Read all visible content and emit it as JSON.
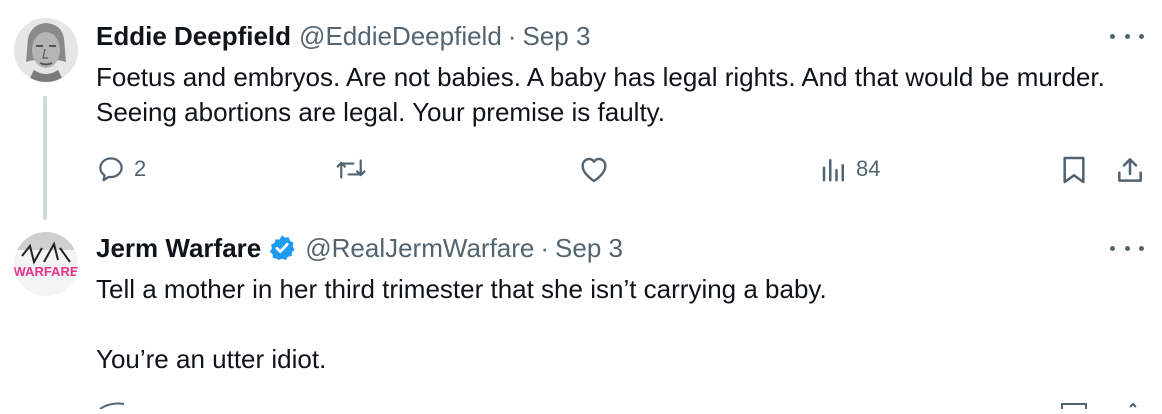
{
  "tweets": [
    {
      "name": "Eddie Deepfield",
      "handle": "@EddieDeepfield",
      "separator": "·",
      "date": "Sep 3",
      "text": "Foetus and embryos. Are not babies. A baby has legal rights. And that would be murder. Seeing abortions are legal. Your premise is  faulty.",
      "reply_count": "2",
      "views_count": "84",
      "verified": false
    },
    {
      "name": "Jerm Warfare",
      "handle": "@RealJermWarfare",
      "separator": "·",
      "date": "Sep 3",
      "text_line1": "Tell a mother in her third trimester that she isn’t carrying a baby.",
      "text_line2": "You’re an utter idiot.",
      "verified": true,
      "avatar_text": "WARFARE"
    }
  ],
  "colors": {
    "text": "#0f1419",
    "secondary": "#536471",
    "verified": "#1d9bf0",
    "thread_line": "#cfd9de",
    "avatar_logo": "#e8308f"
  },
  "icons": [
    "reply-icon",
    "retweet-icon",
    "like-icon",
    "views-icon",
    "bookmark-icon",
    "share-icon",
    "more-icon",
    "verified-badge-icon"
  ]
}
